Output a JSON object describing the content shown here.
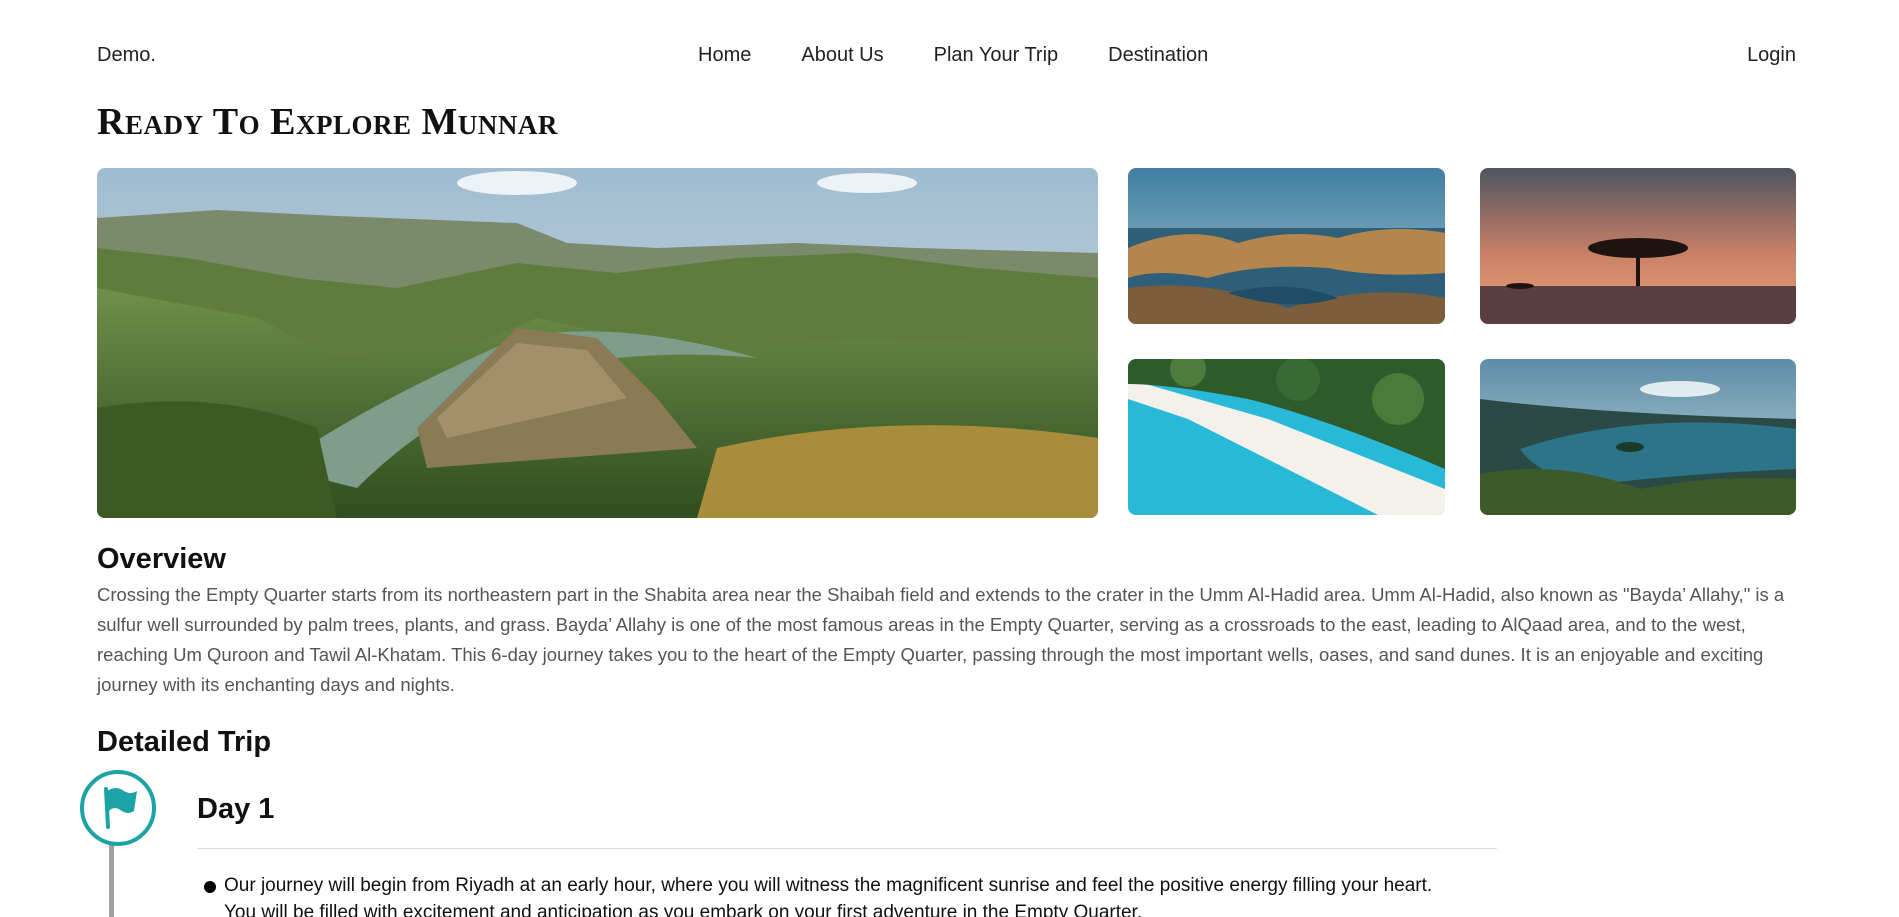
{
  "nav": {
    "brand": "Demo.",
    "links": [
      "Home",
      "About Us",
      "Plan Your Trip",
      "Destination"
    ],
    "login": "Login"
  },
  "page": {
    "title": "Ready To Explore Munnar"
  },
  "gallery": {
    "images": [
      "mountain-canyon-river",
      "coastal-islands-bay",
      "savanna-sunset-tree",
      "tropical-beach-aerial",
      "lake-forest-island"
    ]
  },
  "overview": {
    "heading": "Overview",
    "text": "Crossing the Empty Quarter starts from its northeastern part in the Shabita area near the Shaibah field and extends to the crater in the Umm Al-Hadid area. Umm Al-Hadid, also known as \"Bayda’ Allahy,\" is a sulfur well surrounded by palm trees, plants, and grass. Bayda’ Allahy is one of the most famous areas in the Empty Quarter, serving as a crossroads to the east, leading to AlQaad area, and to the west, reaching Um Quroon and Tawil Al-Khatam. This 6-day journey takes you to the heart of the Empty Quarter, passing through the most important wells, oases, and sand dunes. It is an enjoyable and exciting journey with its enchanting days and nights."
  },
  "detailed": {
    "heading": "Detailed Trip",
    "days": [
      {
        "title": "Day 1",
        "items": [
          "Our journey will begin from Riyadh at an early hour, where you will witness the magnificent sunrise and feel the positive energy filling your heart. You will be filled with excitement and anticipation as you embark on your first adventure in the Empty Quarter."
        ]
      }
    ]
  },
  "colors": {
    "accent": "#1ba3a6",
    "timeline": "#a0a0a0"
  },
  "icons": [
    "flag-icon"
  ]
}
